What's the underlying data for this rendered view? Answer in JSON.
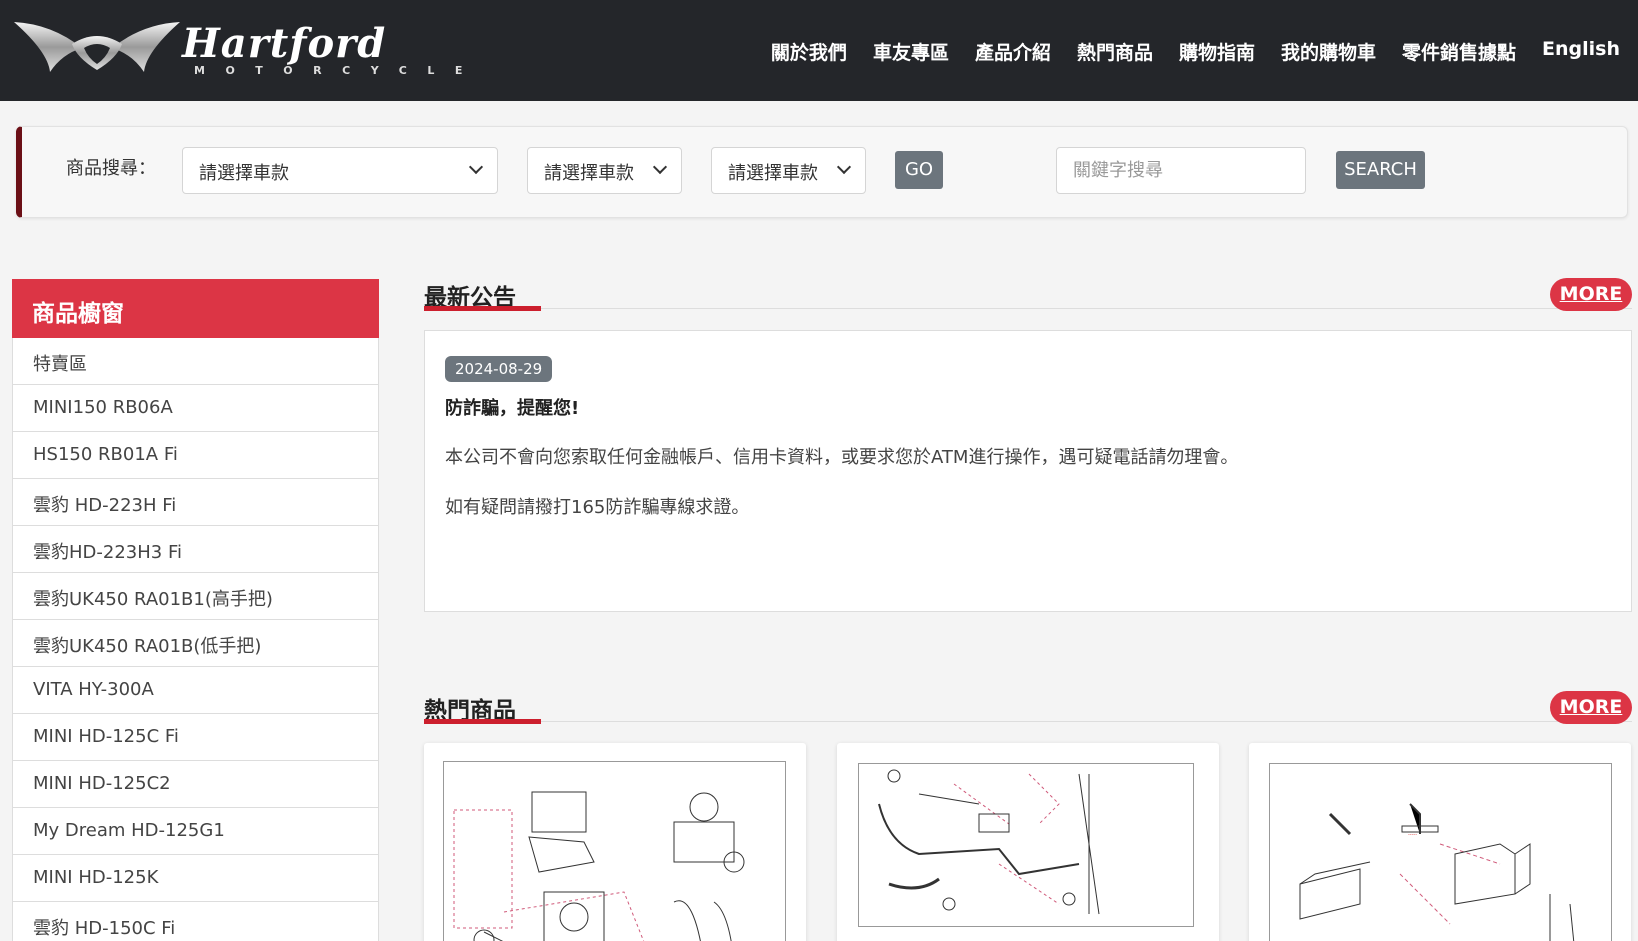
{
  "brand": {
    "name": "Hartford",
    "subtitle": "MOTORCYCLE"
  },
  "nav": {
    "items": [
      "關於我們",
      "車友專區",
      "產品介紹",
      "熱門商品",
      "購物指南",
      "我的購物車",
      "零件銷售據點",
      "English"
    ]
  },
  "search": {
    "label": "商品搜尋：",
    "select1": "請選擇車款",
    "select2": "請選擇車款",
    "select3": "請選擇車款",
    "go_label": "GO",
    "keyword_placeholder": "關鍵字搜尋",
    "search_label": "SEARCH"
  },
  "sidebar": {
    "title": "商品櫥窗",
    "items": [
      "特賣區",
      "MINI150 RB06A",
      "HS150 RB01A Fi",
      "雲豹 HD-223H Fi",
      "雲豹HD-223H3 Fi",
      "雲豹UK450 RA01B1(高手把)",
      "雲豹UK450 RA01B(低手把)",
      "VITA HY-300A",
      "MINI HD-125C Fi",
      "MINI HD-125C2",
      "My Dream HD-125G1",
      "MINI HD-125K",
      "雲豹 HD-150C Fi"
    ]
  },
  "news": {
    "title": "最新公告",
    "more_label": "MORE",
    "date": "2024-08-29",
    "headline": "防詐騙，提醒您!",
    "paragraph1": "本公司不會向您索取任何金融帳戶、信用卡資料，或要求您於ATM進行操作，遇可疑電話請勿理會。",
    "paragraph2": "如有疑問請撥打165防詐騙專線求證。"
  },
  "hot": {
    "title": "熱門商品",
    "more_label": "MORE",
    "products": [
      {
        "image": "engine-cylinder-head-diagram"
      },
      {
        "image": "handlebar-controls-diagram"
      },
      {
        "image": "battery-box-diagram"
      }
    ]
  },
  "colors": {
    "header_bg": "#24262a",
    "accent_red": "#dc3545",
    "underline_red": "#cc1f2d",
    "search_border": "#6b0f16",
    "button_grey": "#6c757d"
  }
}
